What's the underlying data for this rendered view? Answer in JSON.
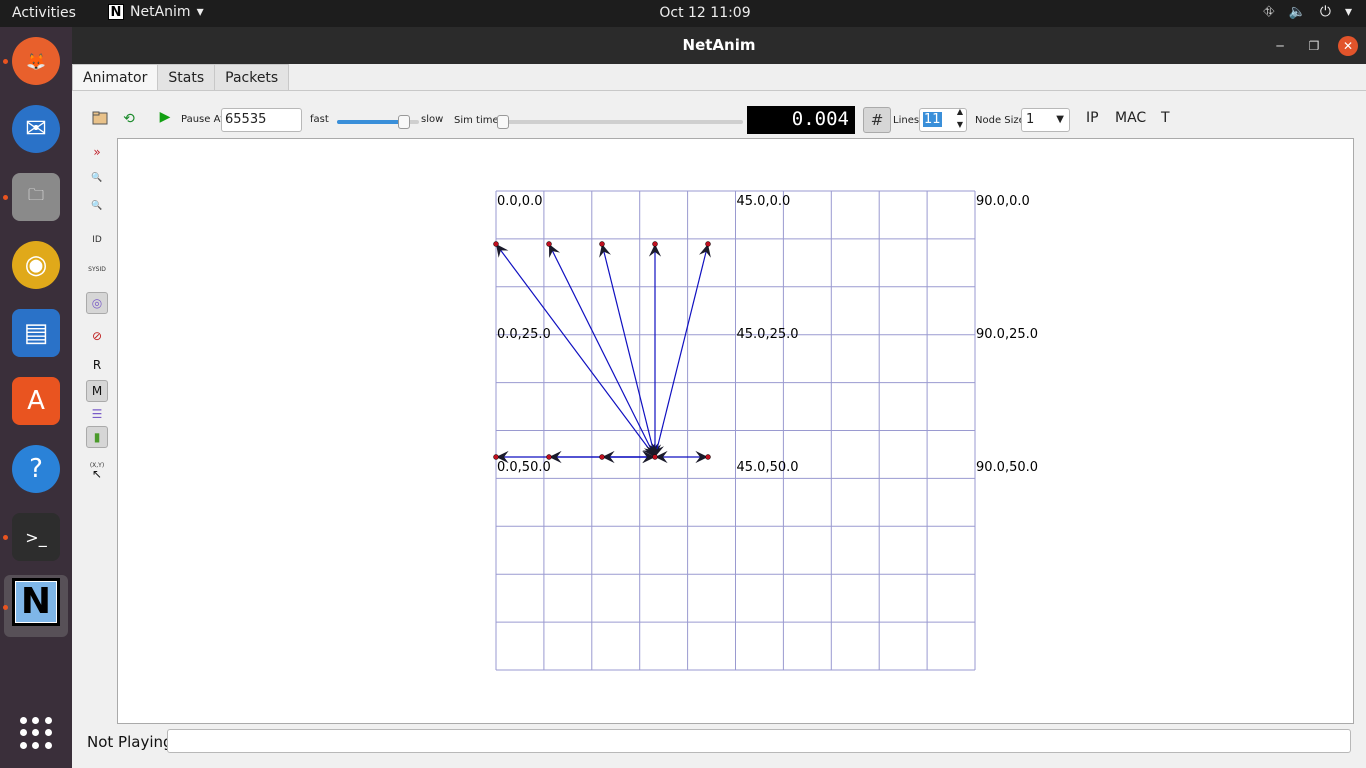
{
  "topbar": {
    "activities": "Activities",
    "app_name": "NetAnim",
    "app_logo_letter": "N",
    "clock": "Oct 12  11:09"
  },
  "dock": {
    "items": [
      {
        "name": "firefox-icon",
        "glyph": "🦊",
        "color": "#e8602c",
        "running": true
      },
      {
        "name": "thunderbird-icon",
        "glyph": "✉",
        "color": "#2a72c8",
        "running": false
      },
      {
        "name": "files-icon",
        "glyph": "🗀",
        "color": "#8a8a8a",
        "running": true
      },
      {
        "name": "rhythmbox-icon",
        "glyph": "◉",
        "color": "#e0a91a",
        "running": false
      },
      {
        "name": "writer-icon",
        "glyph": "▤",
        "color": "#2a72c8",
        "running": false
      },
      {
        "name": "software-icon",
        "glyph": "A",
        "color": "#e95420",
        "running": false
      },
      {
        "name": "help-icon",
        "glyph": "?",
        "color": "#2a82d8",
        "running": false
      },
      {
        "name": "terminal-icon",
        "glyph": ">_",
        "color": "#2d2d2d",
        "running": true
      }
    ],
    "active_app_letter": "N"
  },
  "window": {
    "title": "NetAnim",
    "tabs": [
      {
        "label": "Animator",
        "active": true
      },
      {
        "label": "Stats",
        "active": false
      },
      {
        "label": "Packets",
        "active": false
      }
    ]
  },
  "toolbar": {
    "pause_at_label": "Pause At",
    "pause_at_value": "65535",
    "fast_label": "fast",
    "slow_label": "slow",
    "speed_slider_level": 0.82,
    "sim_time_label": "Sim time",
    "sim_time_slider_level": 0.0,
    "lcd_value": "0.004",
    "lines_label": "Lines",
    "lines_value": "11",
    "node_size_label": "Node Size",
    "node_size_value": "1",
    "ip_button": "IP",
    "mac_button": "MAC",
    "t_button": "T"
  },
  "side_tools": [
    {
      "name": "expand-icon",
      "glyph": "»",
      "color": "#c0202a"
    },
    {
      "name": "zoom-in-icon",
      "glyph": "🔍",
      "color": "#2a5bc8"
    },
    {
      "name": "zoom-out-icon",
      "glyph": "🔍",
      "color": "#2a5bc8"
    },
    {
      "name": "node-id-icon",
      "glyph": "ID",
      "color": "#333333"
    },
    {
      "name": "sys-id-icon",
      "glyph": "SYSID",
      "color": "#333333"
    },
    {
      "name": "wireless-circles-icon",
      "glyph": "◎",
      "color": "#7a5cc8"
    },
    {
      "name": "no-packets-icon",
      "glyph": "⊘",
      "color": "#c02020"
    },
    {
      "name": "r-toggle",
      "glyph": "R",
      "color": "#111111"
    },
    {
      "name": "m-toggle",
      "glyph": "M",
      "color": "#111111"
    },
    {
      "name": "lines-icon",
      "glyph": "☰",
      "color": "#7a5cc8"
    },
    {
      "name": "battery-icon",
      "glyph": "▮",
      "color": "#4a9a2a"
    },
    {
      "name": "xy-icon",
      "glyph": "(X,Y)",
      "color": "#333333"
    },
    {
      "name": "pointer-icon",
      "glyph": "↖",
      "color": "#111111"
    }
  ],
  "canvas": {
    "grid_labels": [
      "0.0,0.0",
      "45.0,0.0",
      "90.0,0.0",
      "0.0,25.0",
      "45.0,25.0",
      "90.0,25.0",
      "0.0,50.0",
      "45.0,50.0",
      "90.0,50.0"
    ],
    "grid_color": "#9a9ad0",
    "link_color": "#1010c0",
    "node_color": "#c01020"
  },
  "status": {
    "label": "Not Playing",
    "field_value": ""
  }
}
